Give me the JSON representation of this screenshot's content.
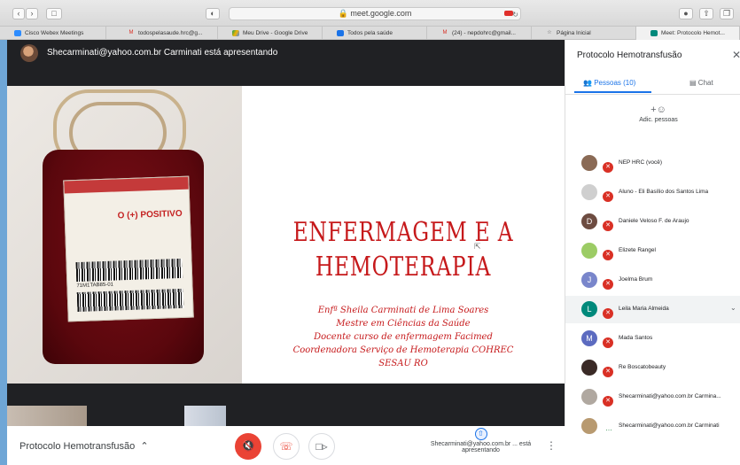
{
  "browser": {
    "url": "meet.google.com",
    "tabs": [
      {
        "label": "Cisco Webex Meetings",
        "icon": "webex-icon"
      },
      {
        "label": "todospelasaude.hrc@g...",
        "icon": "gmail-icon"
      },
      {
        "label": "Meu Drive - Google Drive",
        "icon": "drive-icon"
      },
      {
        "label": "Todos pela saúde",
        "icon": "doc-icon"
      },
      {
        "label": "(24) - nepdohrc@gmail...",
        "icon": "gmail-icon"
      },
      {
        "label": "Página Inicial",
        "icon": "star-icon"
      },
      {
        "label": "Meet: Protocolo Hemot...",
        "icon": "meet-icon"
      }
    ]
  },
  "meeting": {
    "presenter_banner": "Shecarminati@yahoo.com.br Carminati está apresentando",
    "name": "Protocolo Hemotransfusão",
    "presenting_label": "Shecarminati@yahoo.com.br ... está apresentando"
  },
  "slide": {
    "title_line1": "ENFERMAGEM E A",
    "title_line2": "HEMOTERAPIA",
    "lines": [
      "Enfª Sheila Carminati de Lima Soares",
      "Mestre em Ciências da Saúde",
      "Docente curso de enfermagem Facimed",
      "Coordenadora Serviço de Hemoterapia COHREC",
      "SESAU RO"
    ],
    "photo_label_blood_type": "O (+) POSITIVO",
    "photo_barcode_number": "71M1TAB85-01"
  },
  "panel": {
    "title": "Protocolo Hemotransfusão",
    "people_tab": "Pessoas (10)",
    "chat_tab": "Chat",
    "add_people": "Adic. pessoas",
    "participants": [
      {
        "name": "NEP HRC (você)",
        "initial": "",
        "color": "#8a6a55",
        "muted": true
      },
      {
        "name": "Aluno - Eli Basílio dos Santos Lima",
        "initial": "",
        "color": "#cfcfcf",
        "muted": true
      },
      {
        "name": "Daniele Veloso F. de Araujo",
        "initial": "D",
        "color": "#6d4c41",
        "muted": true
      },
      {
        "name": "Elizete Rangel",
        "initial": "",
        "color": "#9ccc65",
        "muted": true
      },
      {
        "name": "Joelma Brum",
        "initial": "J",
        "color": "#7986cb",
        "muted": true
      },
      {
        "name": "Leila Maria Almeida",
        "initial": "L",
        "color": "#00897b",
        "muted": true
      },
      {
        "name": "Mada Santos",
        "initial": "M",
        "color": "#5c6bc0",
        "muted": true
      },
      {
        "name": "Re Boscatobeauty",
        "initial": "",
        "color": "#3a2a26",
        "muted": true
      },
      {
        "name": "Shecarminati@yahoo.com.br Carmina...",
        "initial": "",
        "color": "#b0a8a0",
        "muted": true
      },
      {
        "name": "Shecarminati@yahoo.com.br Carminati",
        "initial": "",
        "color": "#b89a70",
        "muted": false
      }
    ]
  }
}
